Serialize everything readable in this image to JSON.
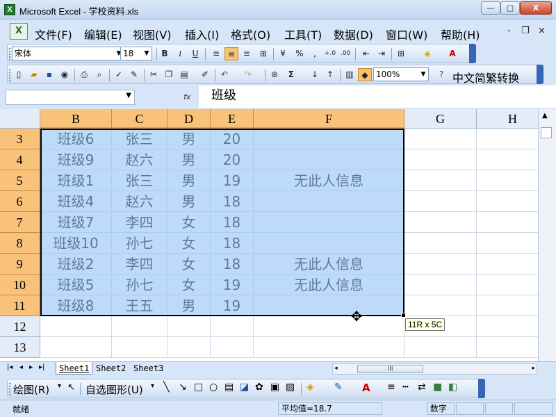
{
  "window": {
    "title": "Microsoft Excel - 学校资料.xls",
    "app_icon": "X",
    "minimize": "—",
    "maximize": "□",
    "close": "X"
  },
  "menu": {
    "items": [
      "文件(F)",
      "编辑(E)",
      "视图(V)",
      "插入(I)",
      "格式(O)",
      "工具(T)",
      "数据(D)",
      "窗口(W)",
      "帮助(H)"
    ],
    "mdi_min": "-",
    "mdi_restore": "❐",
    "mdi_close": "×"
  },
  "format_toolbar": {
    "font_name": "宋体",
    "font_size": "18",
    "bold": "B",
    "italic": "I",
    "underline": "U",
    "percent": "%",
    "comma": ",",
    "inc_decimal": "+.0",
    "dec_decimal": ".00"
  },
  "standard_toolbar": {
    "zoom": "100%",
    "autosum": "Σ",
    "convert": "中文简繁转换"
  },
  "formula_bar": {
    "name_box": "",
    "fx": "fx",
    "content": "班级"
  },
  "columns": [
    "B",
    "C",
    "D",
    "E",
    "F",
    "G",
    "H"
  ],
  "rows": [
    {
      "num": "3",
      "cells": [
        "班级6",
        "张三",
        "男",
        "20",
        "",
        "",
        ""
      ]
    },
    {
      "num": "4",
      "cells": [
        "班级9",
        "赵六",
        "男",
        "20",
        "",
        "",
        ""
      ]
    },
    {
      "num": "5",
      "cells": [
        "班级1",
        "张三",
        "男",
        "19",
        "无此人信息",
        "",
        ""
      ]
    },
    {
      "num": "6",
      "cells": [
        "班级4",
        "赵六",
        "男",
        "18",
        "",
        "",
        ""
      ]
    },
    {
      "num": "7",
      "cells": [
        "班级7",
        "李四",
        "女",
        "18",
        "",
        "",
        ""
      ]
    },
    {
      "num": "8",
      "cells": [
        "班级10",
        "孙七",
        "女",
        "18",
        "",
        "",
        ""
      ]
    },
    {
      "num": "9",
      "cells": [
        "班级2",
        "李四",
        "女",
        "18",
        "无此人信息",
        "",
        ""
      ]
    },
    {
      "num": "10",
      "cells": [
        "班级5",
        "孙七",
        "女",
        "19",
        "无此人信息",
        "",
        ""
      ]
    },
    {
      "num": "11",
      "cells": [
        "班级8",
        "王五",
        "男",
        "19",
        "",
        "",
        ""
      ]
    },
    {
      "num": "12",
      "cells": [
        "",
        "",
        "",
        "",
        "",
        "",
        ""
      ]
    },
    {
      "num": "13",
      "cells": [
        "",
        "",
        "",
        "",
        "",
        "",
        ""
      ]
    }
  ],
  "selection_tooltip": "11R x 5C",
  "sheet_tabs": [
    "Sheet1",
    "Sheet2",
    "Sheet3"
  ],
  "hscroll_thumb": "III",
  "draw_toolbar": {
    "draw": "绘图(R)",
    "autoshapes": "自选图形(U)"
  },
  "status": {
    "ready": "就绪",
    "average": "平均值=18.7",
    "mode": "数字"
  }
}
